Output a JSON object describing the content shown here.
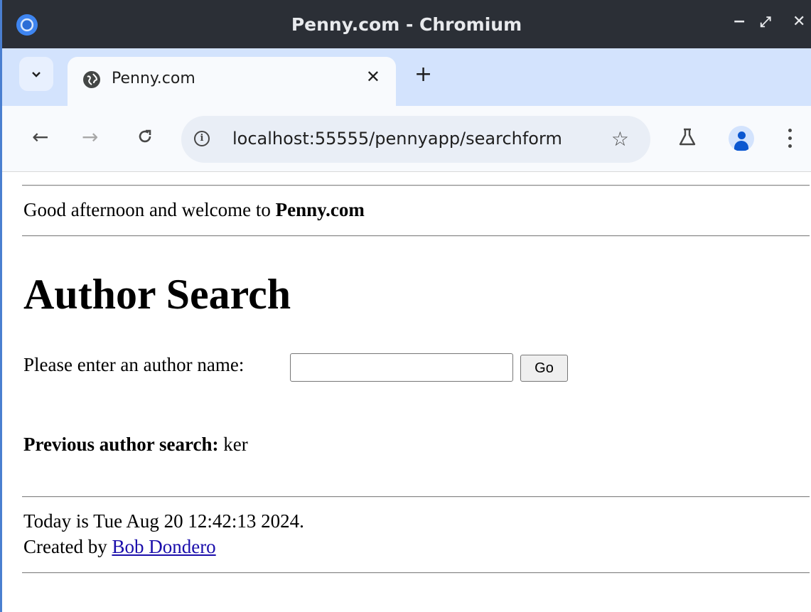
{
  "window": {
    "title": "Penny.com - Chromium",
    "controls": {
      "minimize": "−",
      "maximize": "⤢",
      "close": "✕"
    }
  },
  "tabs": [
    {
      "label": "Penny.com",
      "icon": "globe-icon",
      "active": true
    }
  ],
  "toolbar": {
    "url": "localhost:55555/pennyapp/searchform",
    "icons": [
      "back-icon",
      "forward-icon",
      "reload-icon",
      "site-info-icon",
      "bookmark-star-icon",
      "labs-flask-icon",
      "profile-avatar-icon",
      "menu-icon"
    ]
  },
  "page": {
    "greeting_prefix": "Good afternoon and welcome to ",
    "greeting_site": "Penny.com",
    "heading": "Author Search",
    "search_label": "Please enter an author name:",
    "search_value": "",
    "go_label": "Go",
    "previous_label": "Previous author search:",
    "previous_value": " ker",
    "date_text": "Today is Tue Aug 20 12:42:13 2024.",
    "created_prefix": "Created by ",
    "author_link": "Bob Dondero"
  },
  "colors": {
    "titlebar": "#2b2f36",
    "tabstrip": "#d3e3fd",
    "toolbar": "#f8fafd",
    "omnibox": "#e9eef6",
    "link": "#1a0dab",
    "window_border": "#4a7fd0"
  }
}
